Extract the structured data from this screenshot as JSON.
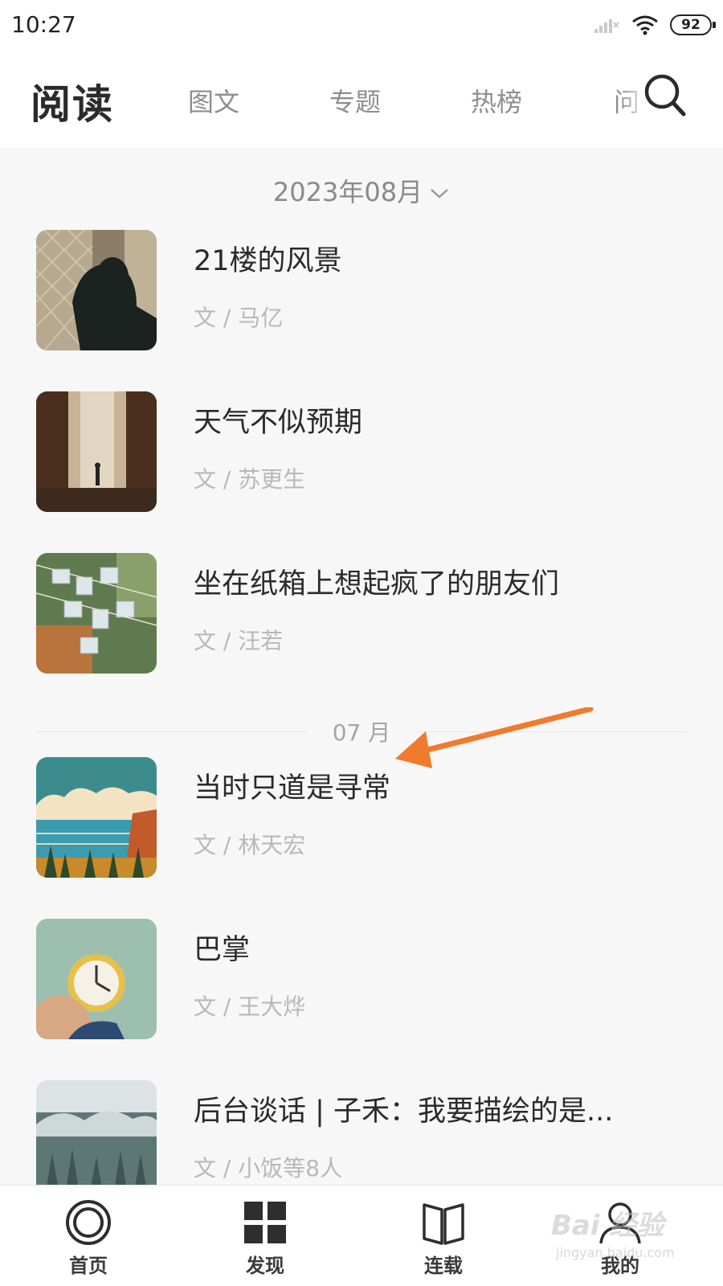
{
  "status_bar": {
    "time": "10:27",
    "battery": "92",
    "icons": [
      "signal-icon",
      "wifi-icon",
      "battery-icon"
    ]
  },
  "header": {
    "title": "阅读",
    "tabs": [
      {
        "label": "图文"
      },
      {
        "label": "专题"
      },
      {
        "label": "热榜"
      },
      {
        "label": "问"
      }
    ],
    "search_icon": "search-icon"
  },
  "date_picker": {
    "label": "2023年08月"
  },
  "month_divider": {
    "label": "07 月"
  },
  "articles": [
    {
      "title": "21楼的风景",
      "author": "文 / 马亿"
    },
    {
      "title": "天气不似预期",
      "author": "文 / 苏更生"
    },
    {
      "title": "坐在纸箱上想起疯了的朋友们",
      "author": "文 / 汪若"
    },
    {
      "title": "当时只道是寻常",
      "author": "文 / 林天宏"
    },
    {
      "title": "巴掌",
      "author": "文 / 王大烨"
    },
    {
      "title": "后台谈话 | 子禾：我要描绘的是...",
      "author": "文 / 小饭等8人"
    }
  ],
  "bottom_nav": {
    "items": [
      {
        "label": "首页",
        "icon": "home-ring-icon"
      },
      {
        "label": "发现",
        "icon": "grid-icon"
      },
      {
        "label": "连载",
        "icon": "book-icon"
      },
      {
        "label": "我的",
        "icon": "user-icon"
      }
    ]
  },
  "watermark": {
    "main": "Bai 经验",
    "sub": "jingyan.baidu.com"
  },
  "colors": {
    "annotation_arrow": "#f07b2c",
    "background": "#f7f7f7",
    "title_text": "#2a2a2a",
    "muted_text": "#b8b8b8"
  }
}
